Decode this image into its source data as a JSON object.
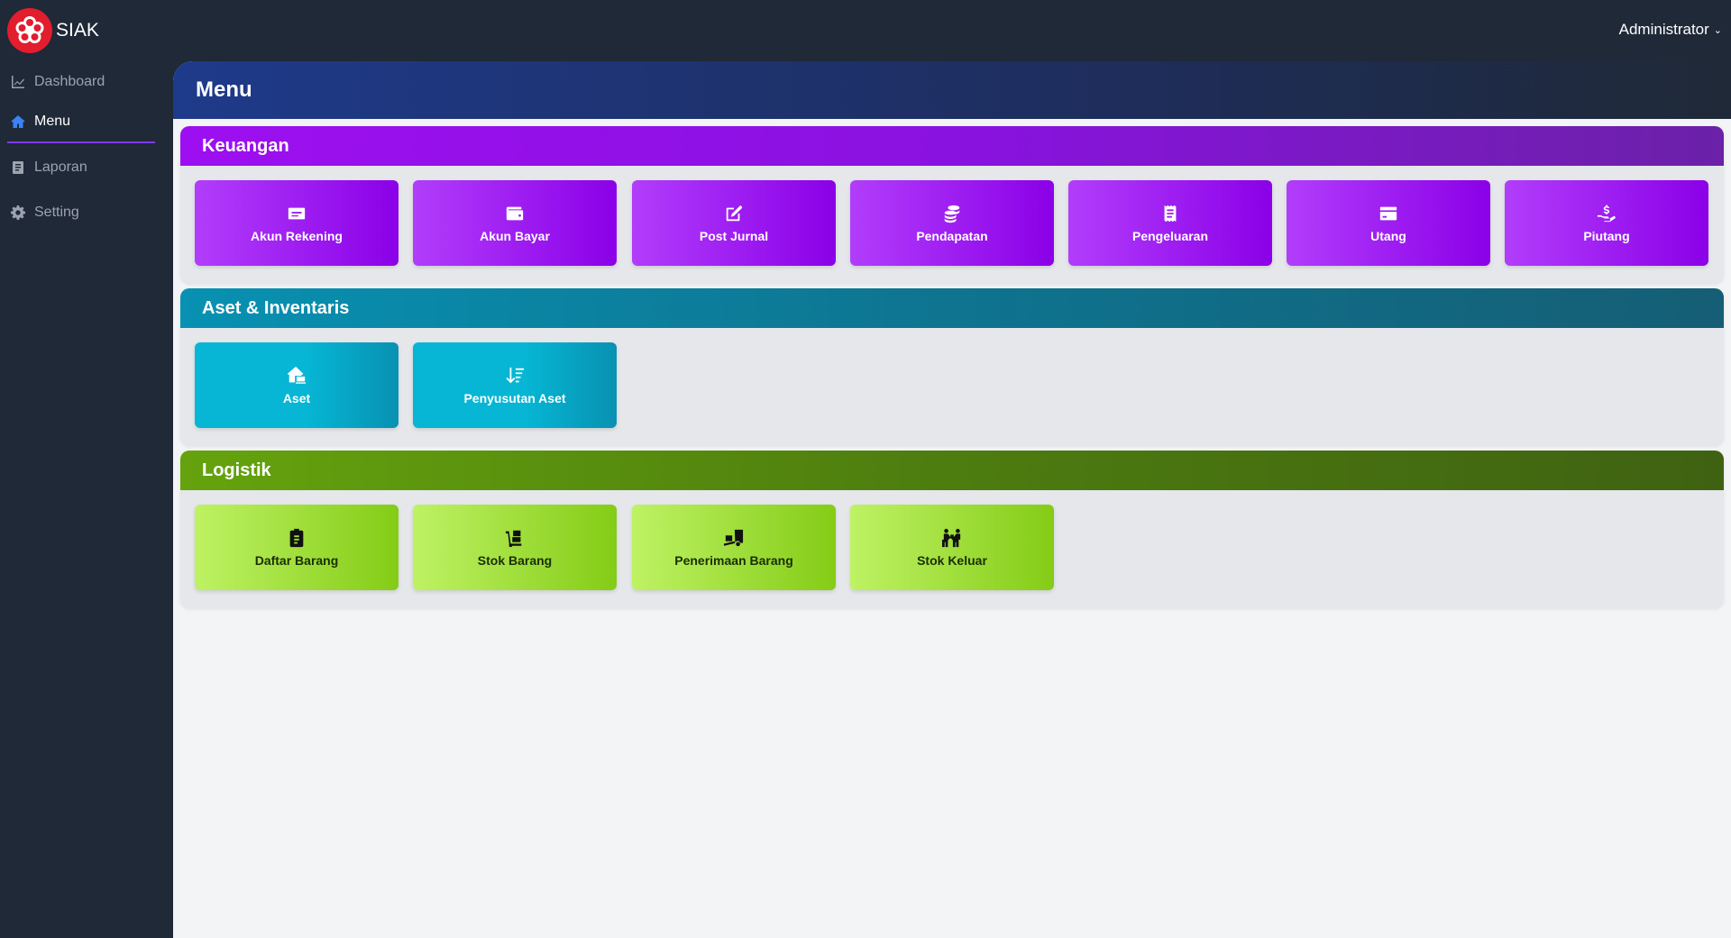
{
  "app": {
    "brand": "SIAK",
    "user": "Administrator",
    "colors": {
      "sidebar_bg": "#1f2937",
      "logo_red": "#e11d2e",
      "active_underline": "#7c3aed",
      "active_icon": "#3b82f6"
    }
  },
  "sidebar": {
    "items": [
      {
        "label": "Dashboard",
        "icon": "chart-line-icon",
        "active": false
      },
      {
        "label": "Menu",
        "icon": "home-icon",
        "active": true
      },
      {
        "label": "Laporan",
        "icon": "file-icon",
        "active": false
      },
      {
        "label": "Setting",
        "icon": "gear-icon",
        "active": false
      }
    ]
  },
  "main": {
    "title": "Menu",
    "sections": [
      {
        "title": "Keuangan",
        "color": "#9d0ff0",
        "cards": [
          {
            "label": "Akun Rekening",
            "icon": "money-check-icon"
          },
          {
            "label": "Akun Bayar",
            "icon": "wallet-icon"
          },
          {
            "label": "Post Jurnal",
            "icon": "edit-icon"
          },
          {
            "label": "Pendapatan",
            "icon": "coins-icon"
          },
          {
            "label": "Pengeluaran",
            "icon": "receipt-icon"
          },
          {
            "label": "Utang",
            "icon": "credit-card-icon"
          },
          {
            "label": "Piutang",
            "icon": "hand-holding-dollar-icon"
          }
        ]
      },
      {
        "title": "Aset & Inventaris",
        "color": "#0891b2",
        "cards": [
          {
            "label": "Aset",
            "icon": "house-laptop-icon"
          },
          {
            "label": "Penyusutan Aset",
            "icon": "arrow-down-wide-short-icon"
          }
        ]
      },
      {
        "title": "Logistik",
        "color": "#65a30d",
        "cards": [
          {
            "label": "Daftar Barang",
            "icon": "clipboard-list-icon"
          },
          {
            "label": "Stok Barang",
            "icon": "dolly-icon"
          },
          {
            "label": "Penerimaan Barang",
            "icon": "truck-ramp-box-icon"
          },
          {
            "label": "Stok Keluar",
            "icon": "people-carry-box-icon"
          }
        ]
      }
    ]
  }
}
